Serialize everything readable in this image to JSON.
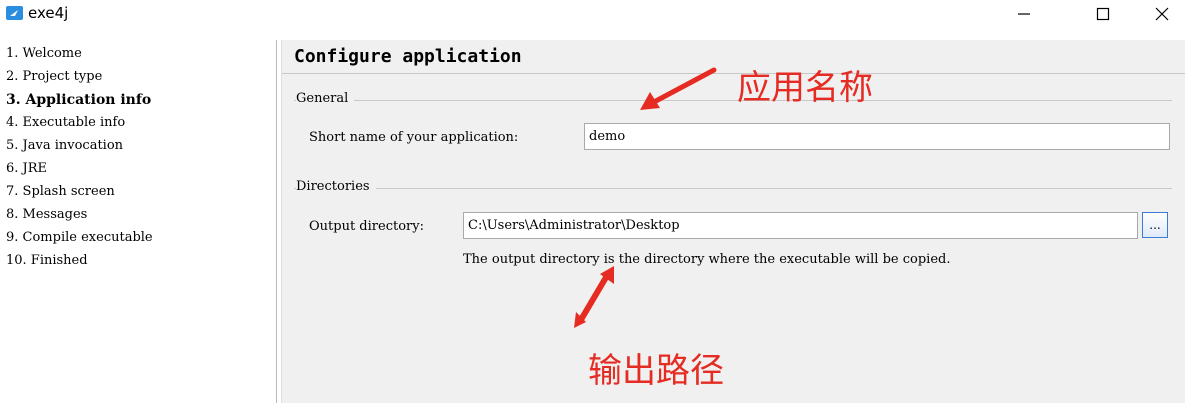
{
  "window": {
    "title": "exe4j"
  },
  "sidebar": {
    "steps": [
      {
        "label": "1. Welcome"
      },
      {
        "label": "2. Project type"
      },
      {
        "label": "3. Application info"
      },
      {
        "label": "4. Executable info"
      },
      {
        "label": "5. Java invocation"
      },
      {
        "label": "6. JRE"
      },
      {
        "label": "7. Splash screen"
      },
      {
        "label": "8. Messages"
      },
      {
        "label": "9. Compile executable"
      },
      {
        "label": "10. Finished"
      }
    ],
    "active_index": 2
  },
  "main": {
    "title": "Configure application",
    "general": {
      "section_label": "General",
      "short_name_label": "Short name of your application:",
      "short_name_value": "demo"
    },
    "directories": {
      "section_label": "Directories",
      "output_label": "Output directory:",
      "output_value": "C:\\Users\\Administrator\\Desktop",
      "browse_label": "...",
      "hint": "The output directory is the directory where the executable will be copied."
    }
  },
  "annotations": {
    "app_name_note": "应用名称",
    "output_path_note": "输出路径",
    "color": "#e52b22"
  },
  "icons": {
    "app": "exe4j-app-icon",
    "minimize": "minimize-icon",
    "maximize": "maximize-icon",
    "close": "close-icon"
  }
}
